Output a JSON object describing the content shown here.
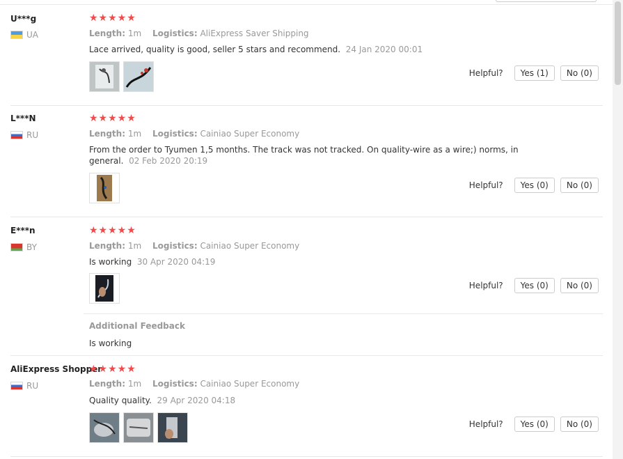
{
  "reviews": [
    {
      "user": "U***g",
      "country": "UA",
      "stars": "★★★★★",
      "length_label": "Length:",
      "length_value": "1m",
      "logistics_label": "Logistics:",
      "logistics_value": "AliExpress Saver Shipping",
      "text": "Lace arrived, quality is good, seller 5 stars and recommend.",
      "date": "24 Jan 2020 00:01",
      "helpful_label": "Helpful?",
      "yes_label": "Yes (1)",
      "no_label": "No (0)"
    },
    {
      "user": "L***N",
      "country": "RU",
      "stars": "★★★★★",
      "length_label": "Length:",
      "length_value": "1m",
      "logistics_label": "Logistics:",
      "logistics_value": "Cainiao Super Economy",
      "text": "From the order to Tyumen 1,5 months. The track was not tracked. On quality-wire as a wire;) norms, in general.",
      "date": "02 Feb 2020 20:19",
      "helpful_label": "Helpful?",
      "yes_label": "Yes (0)",
      "no_label": "No (0)"
    },
    {
      "user": "E***n",
      "country": "BY",
      "stars": "★★★★★",
      "length_label": "Length:",
      "length_value": "1m",
      "logistics_label": "Logistics:",
      "logistics_value": "Cainiao Super Economy",
      "text": "Is working",
      "date": "30 Apr 2020 04:19",
      "helpful_label": "Helpful?",
      "yes_label": "Yes (0)",
      "no_label": "No (0)",
      "additional_title": "Additional Feedback",
      "additional_text": "Is working"
    },
    {
      "user": "AliExpress Shopper",
      "country": "RU",
      "stars": "★★★★★",
      "length_label": "Length:",
      "length_value": "1m",
      "logistics_label": "Logistics:",
      "logistics_value": "Cainiao Super Economy",
      "text": "Quality quality.",
      "date": "29 Apr 2020 04:18",
      "helpful_label": "Helpful?",
      "yes_label": "Yes (0)",
      "no_label": "No (0)"
    }
  ]
}
